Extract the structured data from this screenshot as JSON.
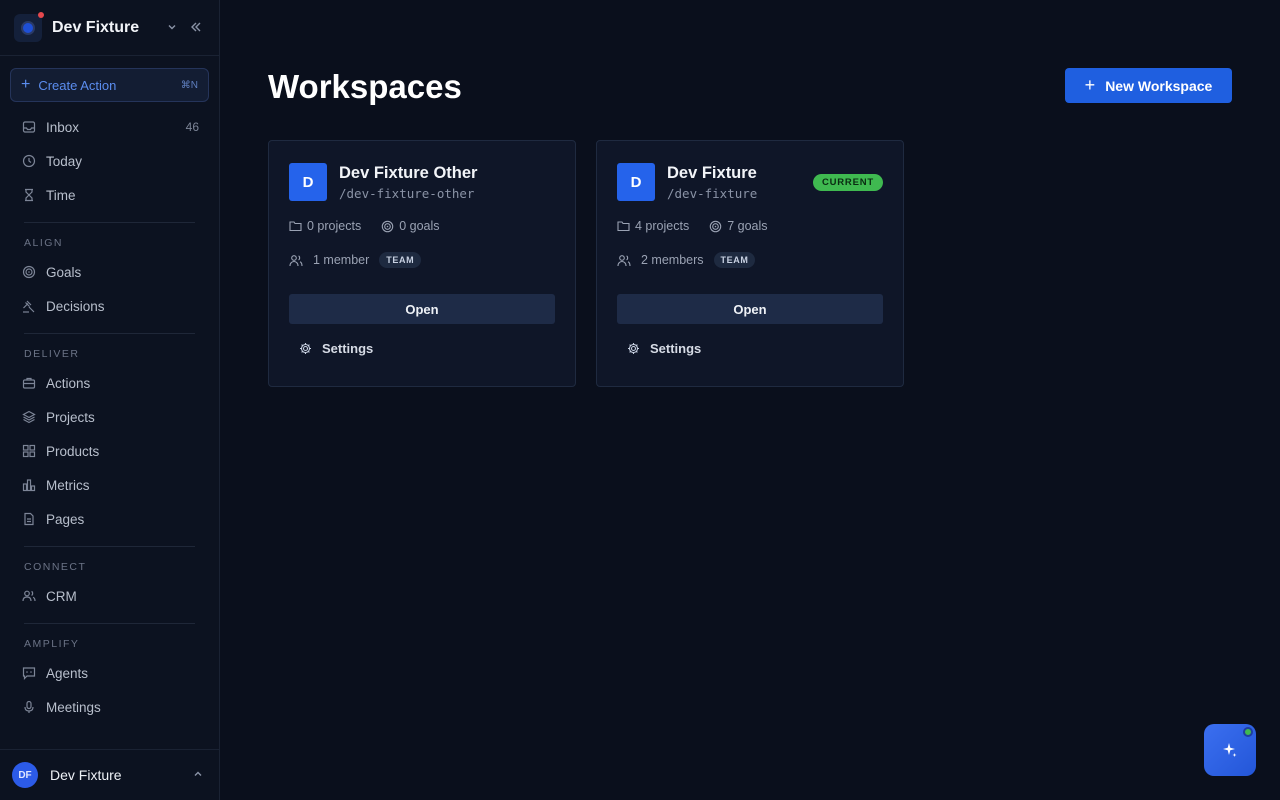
{
  "workspace": {
    "name": "Dev Fixture"
  },
  "sidebar": {
    "create_action": {
      "label": "Create Action",
      "shortcut": "⌘N"
    },
    "top_items": [
      {
        "label": "Inbox",
        "count": "46",
        "icon": "inbox-icon"
      },
      {
        "label": "Today",
        "icon": "clock-icon"
      },
      {
        "label": "Time",
        "icon": "hourglass-icon"
      }
    ],
    "sections": [
      {
        "label": "ALIGN",
        "items": [
          {
            "label": "Goals",
            "icon": "target-icon"
          },
          {
            "label": "Decisions",
            "icon": "gavel-icon"
          }
        ]
      },
      {
        "label": "DELIVER",
        "items": [
          {
            "label": "Actions",
            "icon": "briefcase-icon"
          },
          {
            "label": "Projects",
            "icon": "layers-icon"
          },
          {
            "label": "Products",
            "icon": "grid-icon"
          },
          {
            "label": "Metrics",
            "icon": "bar-chart-icon"
          },
          {
            "label": "Pages",
            "icon": "document-icon"
          }
        ]
      },
      {
        "label": "CONNECT",
        "items": [
          {
            "label": "CRM",
            "icon": "users-icon"
          }
        ]
      },
      {
        "label": "AMPLIFY",
        "items": [
          {
            "label": "Agents",
            "icon": "chat-bot-icon"
          },
          {
            "label": "Meetings",
            "icon": "microphone-icon"
          }
        ]
      }
    ]
  },
  "user": {
    "initials": "DF",
    "name": "Dev Fixture"
  },
  "main": {
    "title": "Workspaces",
    "new_workspace_label": "New Workspace",
    "cards": [
      {
        "initial": "D",
        "name": "Dev Fixture Other",
        "slug": "/dev-fixture-other",
        "projects": "0 projects",
        "goals": "0 goals",
        "members": "1 member",
        "team_badge": "TEAM",
        "current": "",
        "open_label": "Open",
        "settings_label": "Settings"
      },
      {
        "initial": "D",
        "name": "Dev Fixture",
        "slug": "/dev-fixture",
        "projects": "4 projects",
        "goals": "7 goals",
        "members": "2 members",
        "team_badge": "TEAM",
        "current": "CURRENT",
        "open_label": "Open",
        "settings_label": "Settings"
      }
    ]
  },
  "colors": {
    "accent": "#1f5fe0",
    "current_badge": "#3fb950",
    "background": "#0a0f1c"
  }
}
